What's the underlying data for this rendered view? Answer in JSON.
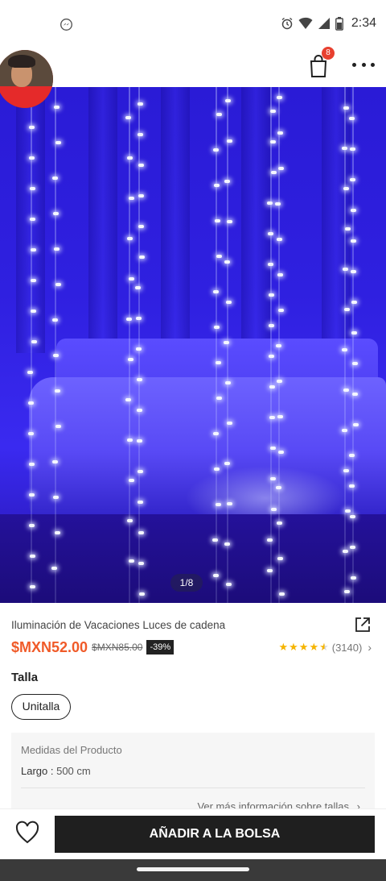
{
  "status_bar": {
    "time": "2:34",
    "icons": [
      "messenger-icon",
      "alarm-icon",
      "wifi-icon",
      "signal-icon",
      "battery-icon"
    ]
  },
  "header": {
    "bag_badge": "8",
    "icons": [
      "bag-icon",
      "more-icon"
    ]
  },
  "product": {
    "image_counter": "1/8",
    "title": "Iluminación de Vacaciones Luces de cadena",
    "price": "$MXN52.00",
    "old_price": "$MXN85.00",
    "discount": "-39%",
    "rating": 4.5,
    "rating_count": "(3140)"
  },
  "size": {
    "label": "Talla",
    "selected": "Unitalla"
  },
  "measurements": {
    "title": "Medidas del Producto",
    "row_label": "Largo : ",
    "row_value": "500 cm",
    "more_link": "Ver más información sobre tallas"
  },
  "actions": {
    "add_to_bag": "AÑADIR A LA BOLSA"
  },
  "colors": {
    "price": "#f05a28",
    "badge": "#e8402f",
    "button": "#1f1f1f",
    "star": "#f5b400"
  }
}
